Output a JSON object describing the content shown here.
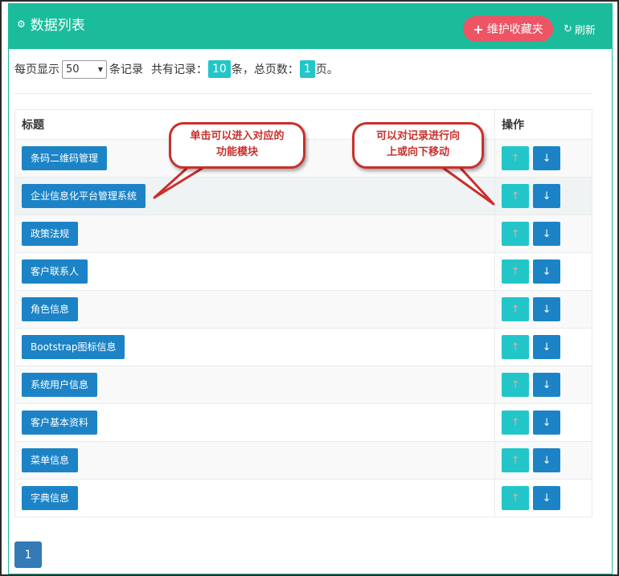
{
  "header": {
    "title": "数据列表",
    "maint_button": "维护收藏夹",
    "refresh_label": "刷新"
  },
  "toolbar": {
    "per_page_prefix": "每页显示",
    "per_page_value": "50",
    "per_page_suffix": "条记录",
    "total_prefix": "共有记录：",
    "total_count": "10",
    "pages_prefix": "条，总页数：",
    "pages_count": "1",
    "pages_suffix": "页。"
  },
  "table": {
    "columns": [
      "标题",
      "操作"
    ],
    "rows": [
      "条码二维码管理",
      "企业信息化平台管理系统",
      "政策法规",
      "客户联系人",
      "角色信息",
      "Bootstrap图标信息",
      "系统用户信息",
      "客户基本资料",
      "菜单信息",
      "字典信息"
    ]
  },
  "pagination": {
    "current": "1"
  },
  "callouts": {
    "left_line1": "单击可以进入对应的",
    "left_line2": "功能模块",
    "right_line1": "可以对记录进行向",
    "right_line2": "上或向下移动"
  },
  "colors": {
    "header": "#1abc9c",
    "danger": "#ed5565",
    "info": "#23c6c8",
    "primary": "#1c84c6",
    "callout": "#c9302c"
  },
  "icons": {
    "title": "cogs-icon",
    "maint": "plus-icon",
    "refresh": "refresh-icon",
    "up": "arrow-up-icon",
    "down": "arrow-down-icon"
  }
}
